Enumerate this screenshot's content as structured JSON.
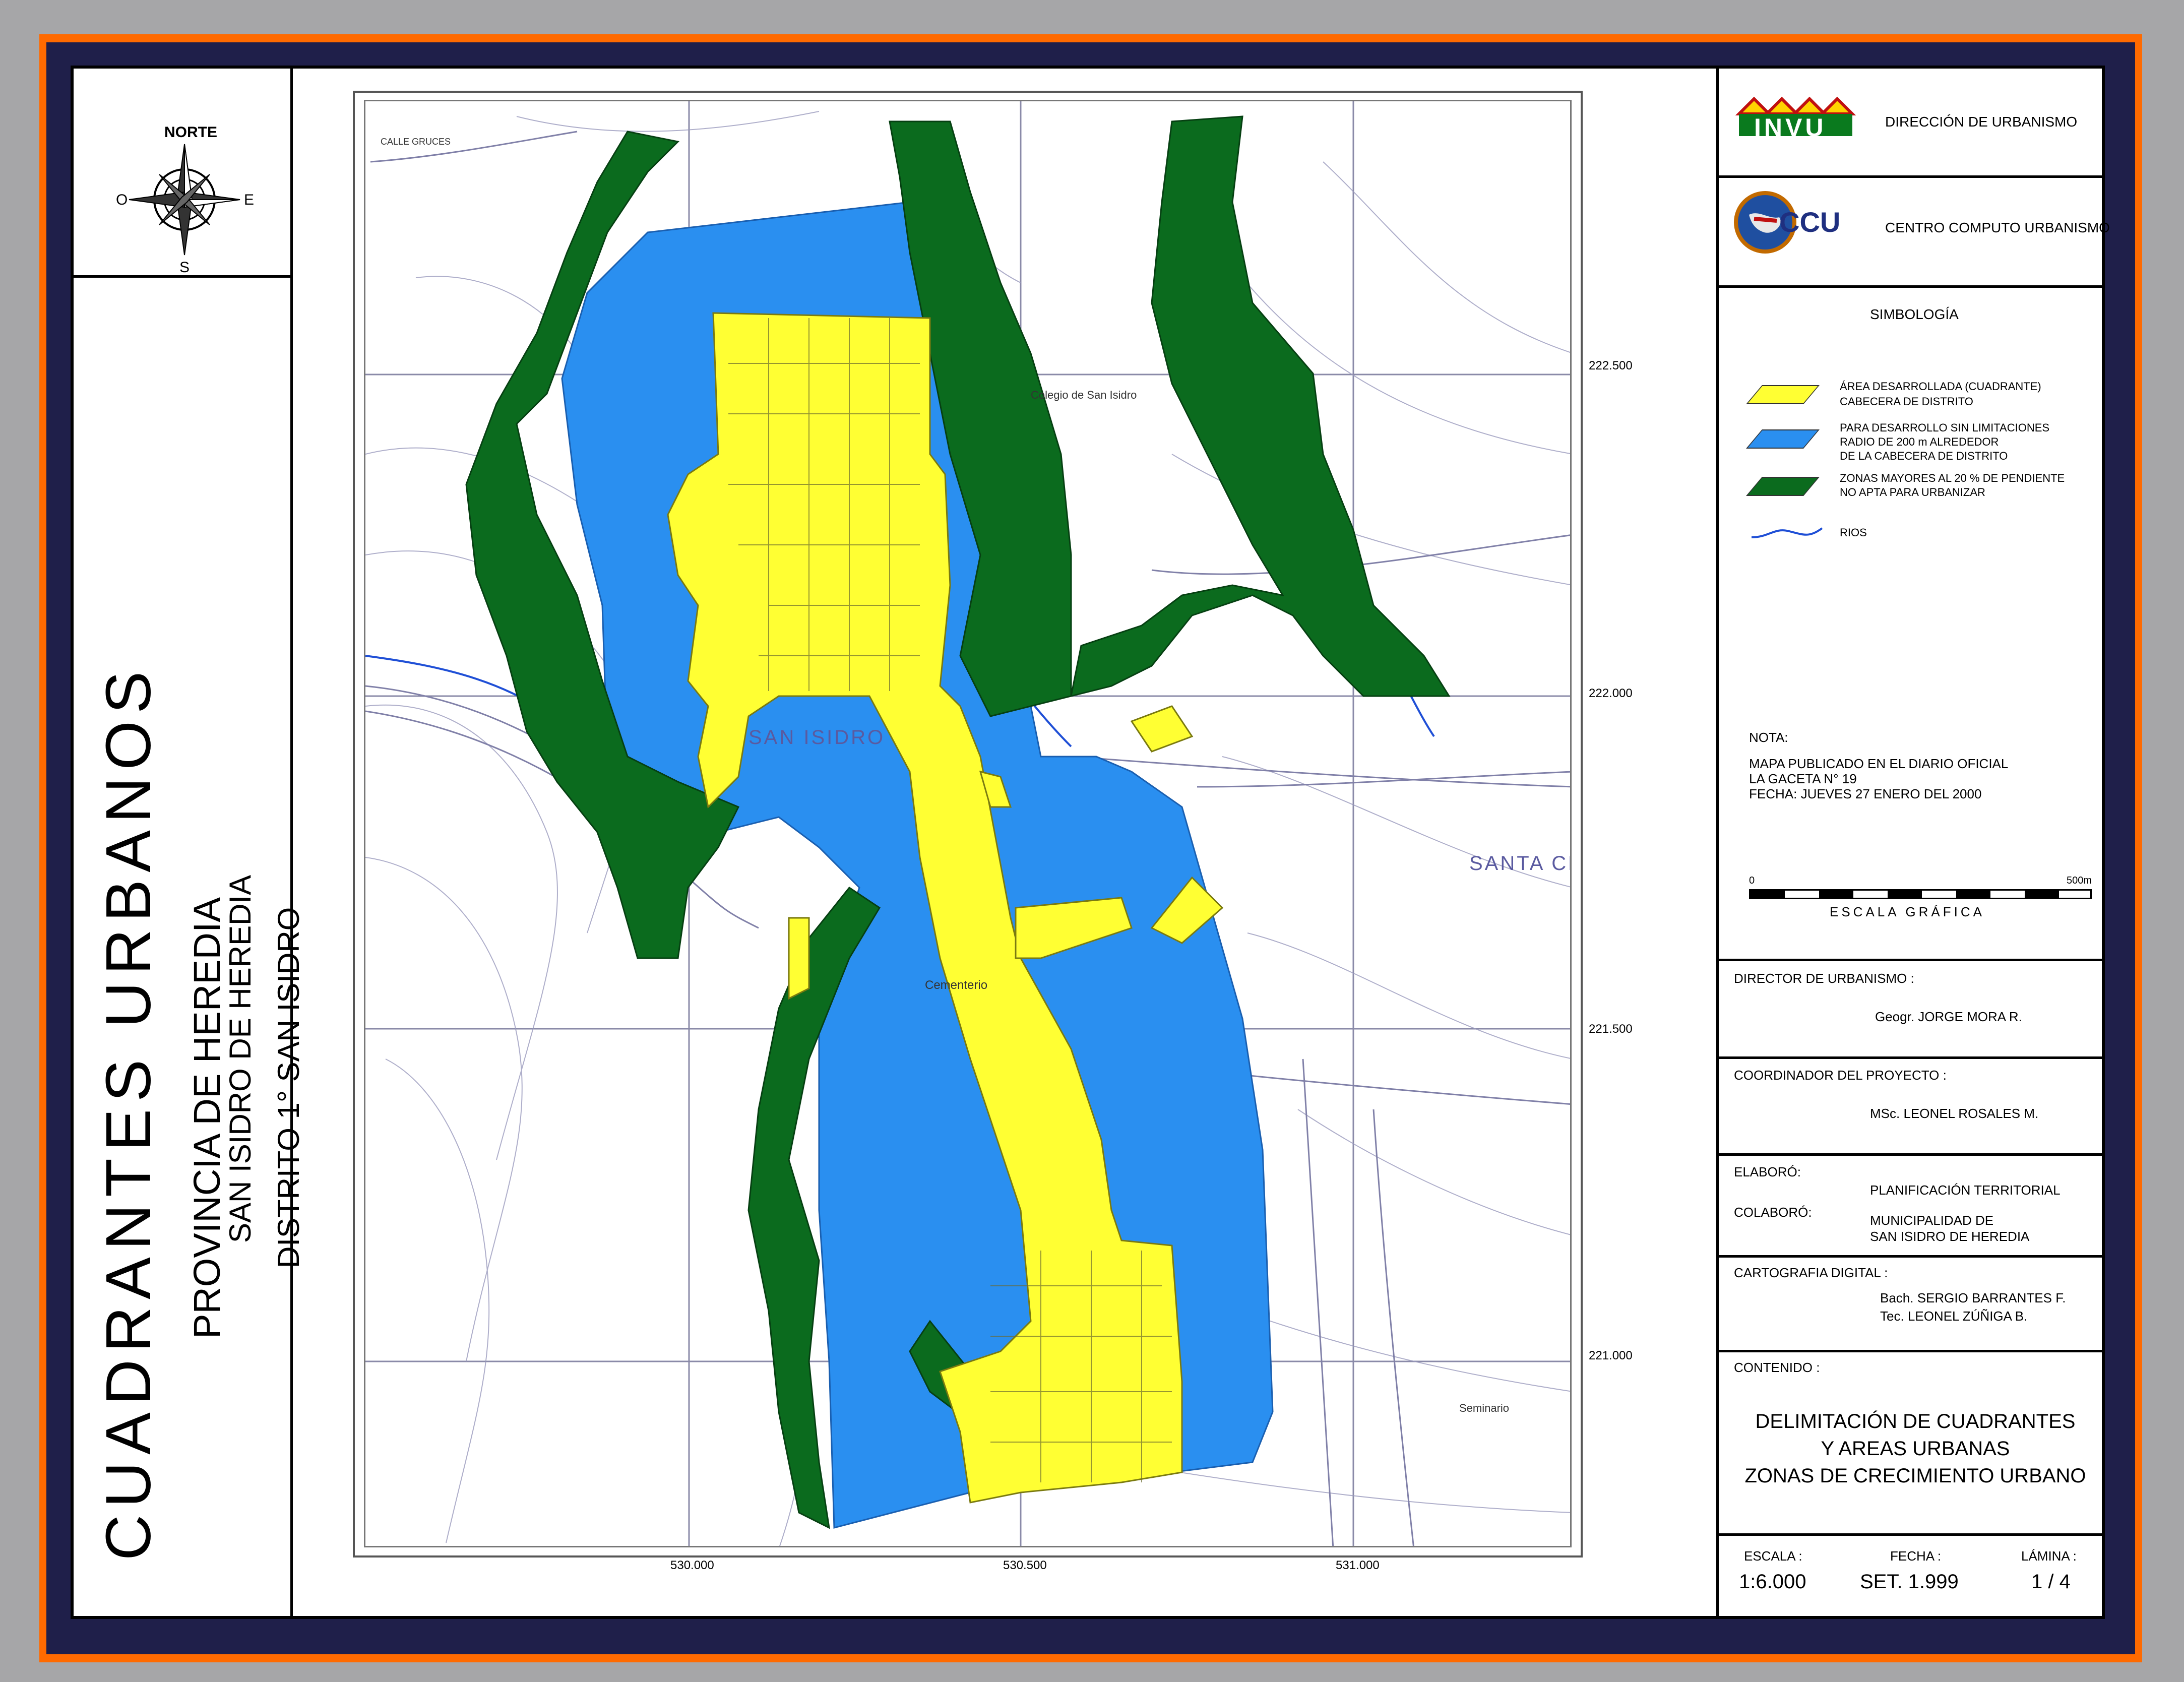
{
  "colors": {
    "developed": "#ffff33",
    "expansion": "#2a8ff0",
    "steep": "#0b6b1e",
    "river": "#1f4fd6",
    "orange_frame": "#ff6a00",
    "navy_frame": "#1f1f4a"
  },
  "compass": {
    "north": "NORTE",
    "south": "S",
    "east": "E",
    "west": "O"
  },
  "left_panel": {
    "title": "CUADRANTES  URBANOS",
    "province": "PROVINCIA  DE  HEREDIA",
    "canton": "SAN ISIDRO  DE  HEREDIA",
    "district": "DISTRITO  1°  SAN ISIDRO"
  },
  "map": {
    "grid_x": [
      "530.000",
      "530.500",
      "531.000"
    ],
    "grid_y": [
      "222.500",
      "222.000",
      "221.500",
      "221.000"
    ],
    "place_labels": {
      "town": "SAN ISIDRO",
      "santa_cruz": "SANTA CRU",
      "cemetery": "Cementerio",
      "school": "Colegio de San Isidro",
      "seminary": "Seminario",
      "street": "CALLE GRUCES"
    }
  },
  "header": {
    "invu_logo": "INVU",
    "invu_text": "DIRECCIÓN DE URBANISMO",
    "ccu_logo": "CCU",
    "ccu_text": "CENTRO COMPUTO URBANISMO"
  },
  "legend": {
    "title": "SIMBOLOGÍA",
    "items": [
      {
        "line1": "ÁREA DESARROLLADA (CUADRANTE)",
        "line2": "CABECERA DE DISTRITO",
        "line3": ""
      },
      {
        "line1": "PARA DESARROLLO SIN LIMITACIONES",
        "line2": "RADIO DE 200 m ALREDEDOR",
        "line3": "DE LA CABECERA DE DISTRITO"
      },
      {
        "line1": "ZONAS MAYORES AL 20 % DE PENDIENTE",
        "line2": "NO APTA PARA URBANIZAR",
        "line3": ""
      },
      {
        "line1": "RIOS",
        "line2": "",
        "line3": ""
      }
    ]
  },
  "note": {
    "heading": "NOTA:",
    "line1": "MAPA PUBLICADO EN EL DIARIO OFICIAL",
    "line2": "LA GACETA  N°  19",
    "line3": "FECHA:  JUEVES 27 ENERO DEL 2000"
  },
  "scale_bar": {
    "start": "0",
    "end": "500m",
    "label": "ESCALA   GRÁFICA"
  },
  "credits": {
    "director_label": "DIRECTOR DE URBANISMO :",
    "director_name": "Geogr. JORGE MORA R.",
    "coordinator_label": "COORDINADOR DEL PROYECTO :",
    "coordinator_name": "MSc. LEONEL ROSALES M.",
    "elaboro_label": "ELABORÓ:",
    "elaboro_value": "PLANIFICACIÓN TERRITORIAL",
    "colaboro_label": "COLABORÓ:",
    "colaboro_line1": "MUNICIPALIDAD DE",
    "colaboro_line2": "SAN ISIDRO DE HEREDIA",
    "cartografia_label": "CARTOGRAFIA DIGITAL :",
    "cartografia_name1": "Bach. SERGIO BARRANTES F.",
    "cartografia_name2": "Tec.  LEONEL ZÚÑIGA B."
  },
  "contenido": {
    "label": "CONTENIDO :",
    "line1": "DELIMITACIÓN DE CUADRANTES",
    "line2": "Y AREAS URBANAS",
    "line3": "ZONAS DE CRECIMIENTO URBANO"
  },
  "footer": {
    "escala_label": "ESCALA :",
    "escala_value": "1:6.000",
    "fecha_label": "FECHA :",
    "fecha_value": "SET.  1.999",
    "lamina_label": "LÁMINA :",
    "lamina_value": "1 / 4"
  }
}
